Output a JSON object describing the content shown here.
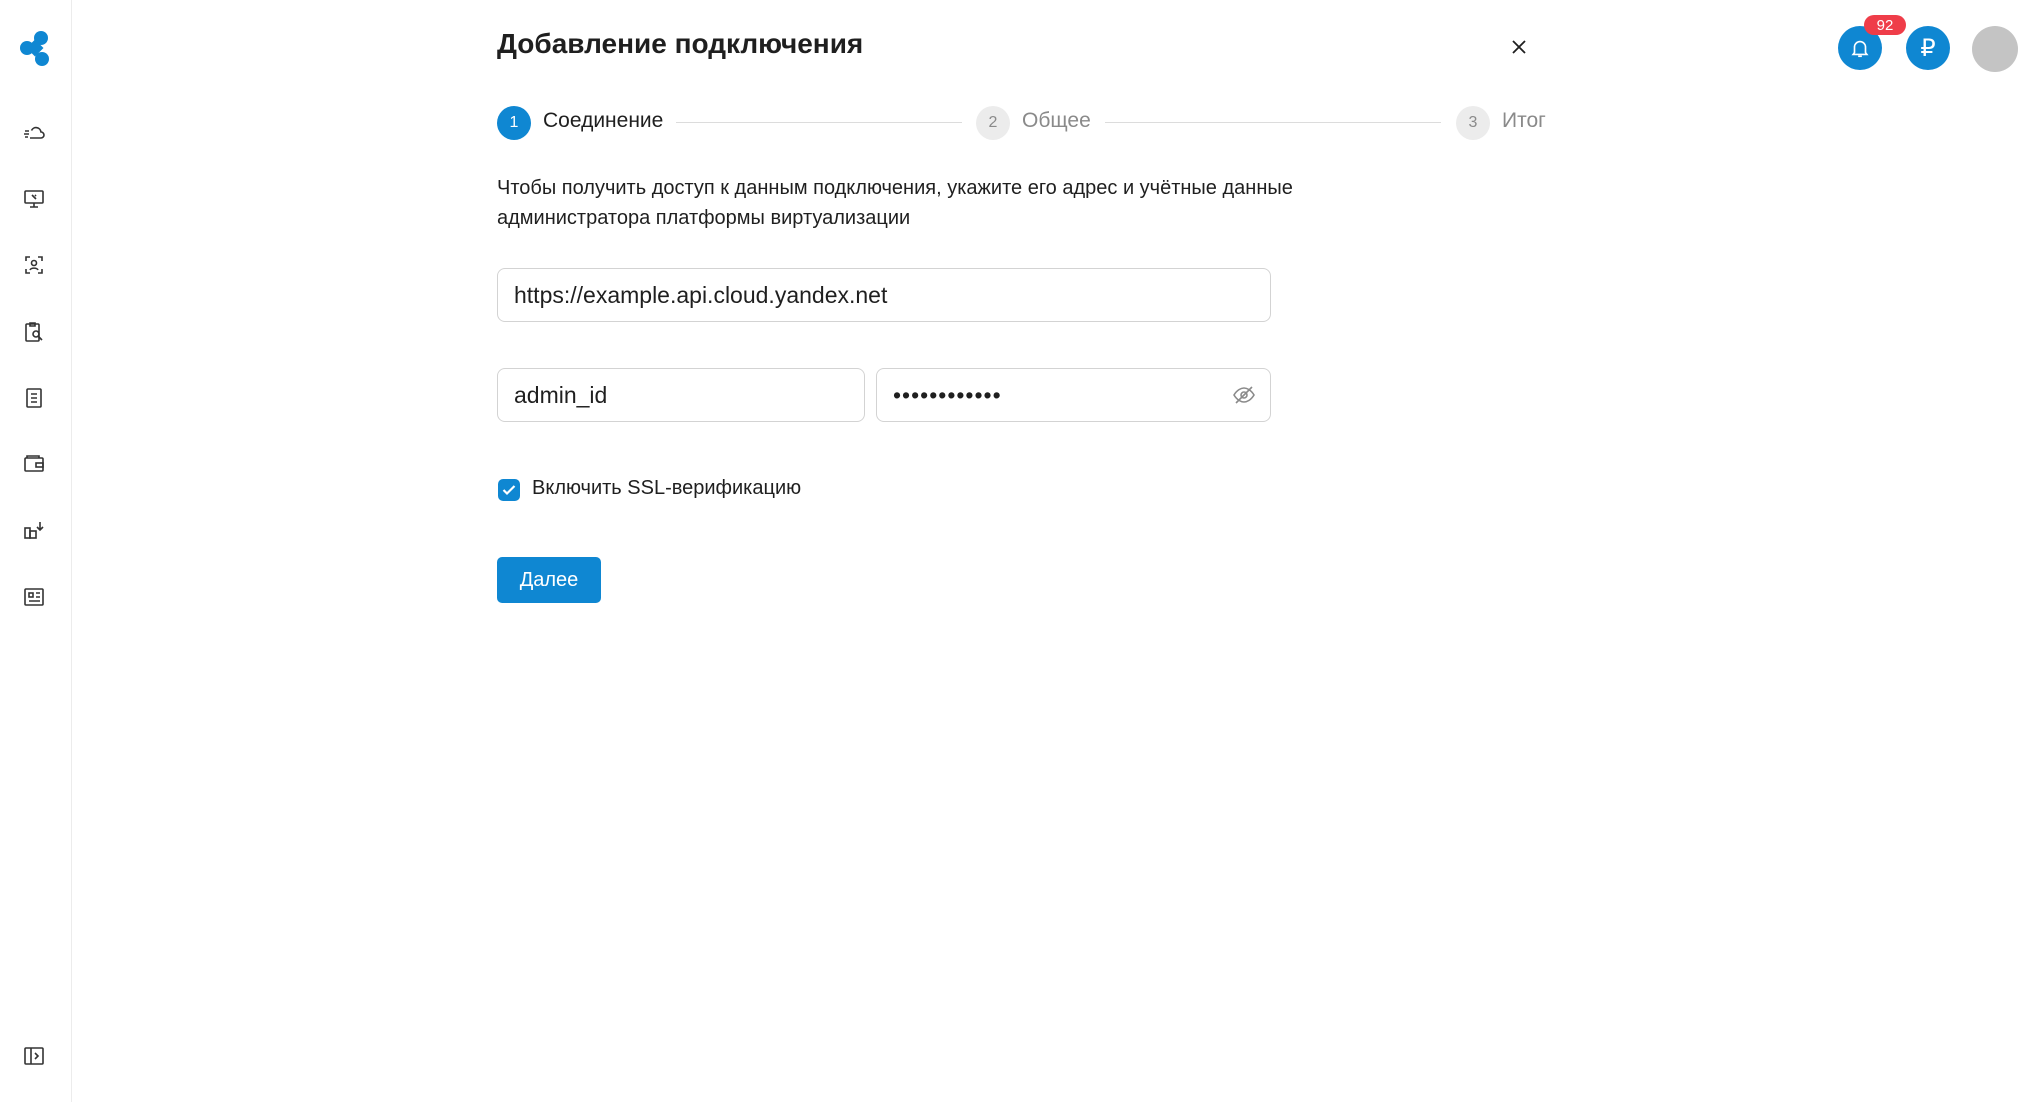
{
  "header": {
    "title": "Добавление подключения",
    "notifications_count": "92",
    "currency_symbol": "₽"
  },
  "stepper": {
    "steps": [
      {
        "number": "1",
        "label": "Соединение",
        "state": "active"
      },
      {
        "number": "2",
        "label": "Общее",
        "state": "inactive"
      },
      {
        "number": "3",
        "label": "Итог",
        "state": "inactive"
      }
    ]
  },
  "form": {
    "description": "Чтобы получить доступ к данным подключения, укажите его адрес и учётные данные администратора платформы виртуализации",
    "url_value": "https://example.api.cloud.yandex.net",
    "login_value": "admin_id",
    "password_value": "••••••••••••",
    "ssl_checkbox": {
      "label": "Включить SSL-верификацию",
      "checked": true
    },
    "next_button": "Далее"
  },
  "sidebar": {
    "items": [
      "cloud-icon",
      "monitor-icon",
      "user-frame-icon",
      "clipboard-search-icon",
      "document-list-icon",
      "wallet-icon",
      "organization-icon",
      "dashboard-icon"
    ],
    "bottom": "collapse-panel-icon"
  },
  "colors": {
    "accent": "#0f87d2",
    "badge": "#ef3d49",
    "avatar": "#c4c4c4"
  }
}
